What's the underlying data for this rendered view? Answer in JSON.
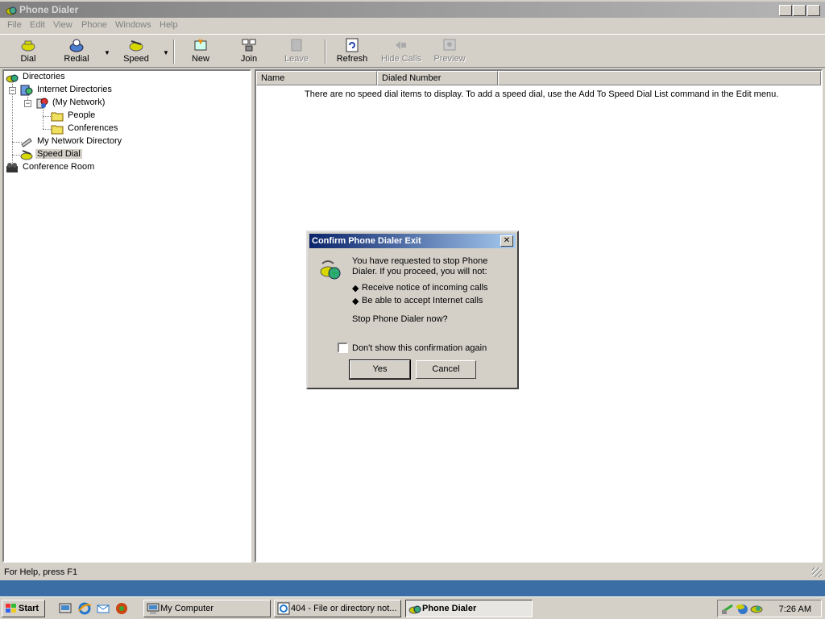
{
  "window": {
    "title": "Phone Dialer"
  },
  "menu": [
    "File",
    "Edit",
    "View",
    "Phone",
    "Windows",
    "Help"
  ],
  "toolbar": {
    "dial": "Dial",
    "redial": "Redial",
    "speed": "Speed",
    "new": "New",
    "join": "Join",
    "leave": "Leave",
    "refresh": "Refresh",
    "hide_calls": "Hide Calls",
    "preview": "Preview"
  },
  "tree": {
    "directories": "Directories",
    "internet_directories": "Internet Directories",
    "my_network": "(My Network)",
    "people": "People",
    "conferences": "Conferences",
    "my_network_directory": "My Network Directory",
    "speed_dial": "Speed Dial",
    "conference_room": "Conference Room"
  },
  "list": {
    "columns": [
      "Name",
      "Dialed Number"
    ],
    "empty_message": "There are no speed dial items to display.  To add a speed dial, use the Add To Speed Dial List command in the Edit menu."
  },
  "status": {
    "text": "For Help, press F1"
  },
  "dialog": {
    "title": "Confirm Phone Dialer Exit",
    "line1": "You have requested to stop Phone",
    "line2": "Dialer. If you proceed, you will not:",
    "bullet1": "Receive notice of incoming calls",
    "bullet2": "Be able to accept Internet calls",
    "question": "Stop Phone Dialer now?",
    "checkbox_label": "Don't show this confirmation again",
    "checkbox_checked": false,
    "yes": "Yes",
    "cancel": "Cancel"
  },
  "taskbar": {
    "start": "Start",
    "tasks": [
      "My Computer",
      "404 - File or directory not...",
      "Phone Dialer"
    ],
    "clock": "7:26 AM"
  }
}
